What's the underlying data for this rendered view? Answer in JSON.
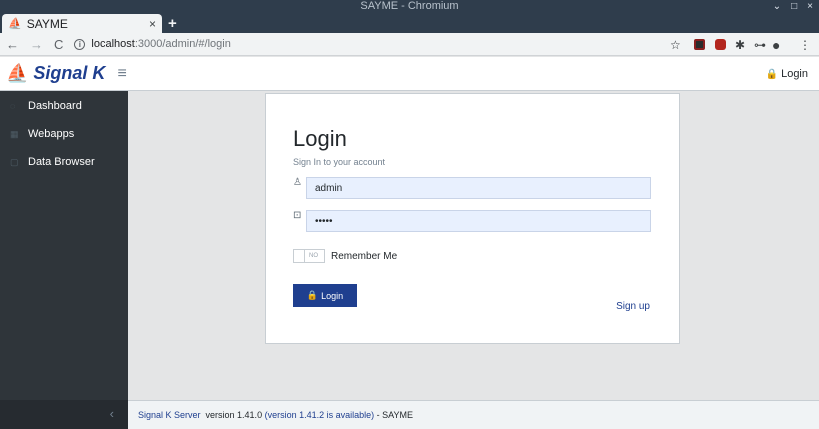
{
  "window": {
    "title": "SAYME - Chromium",
    "controls": [
      "⌄",
      "□",
      "×"
    ]
  },
  "browser": {
    "tab_title": "SAYME",
    "tab_close": "×",
    "new_tab": "+",
    "back": "←",
    "forward": "→",
    "reload": "C",
    "url_host": "localhost",
    "url_rest": ":3000/admin/#/login",
    "info": "i",
    "star": "☆",
    "key": "⊶",
    "profile": "●",
    "menu": "⋮",
    "puzzle": "✱"
  },
  "header": {
    "brand": "Signal K",
    "logo": "⛵",
    "menu_icon": "≡",
    "login_label": "Login",
    "lock": "🔒"
  },
  "sidebar": {
    "items": [
      {
        "label": "Dashboard",
        "icon": "◌"
      },
      {
        "label": "Webapps",
        "icon": "▦"
      },
      {
        "label": "Data Browser",
        "icon": "▢"
      }
    ],
    "collapse": "‹"
  },
  "login": {
    "title": "Login",
    "subtitle": "Sign In to your account",
    "username_value": "admin",
    "username_icon": "♙",
    "password_value": "•••••",
    "password_icon": "⊡",
    "toggle_text": "NO",
    "remember_label": "Remember Me",
    "button_label": "Login",
    "signup_label": "Sign up"
  },
  "footer": {
    "server_link": "Signal K Server",
    "version_text": "  version 1.41.0 ",
    "update_text": "(version 1.41.2 is available)",
    "suffix": " - SAYME"
  },
  "colors": {
    "accent": "#1f3f8f",
    "sidebar": "#2f353a"
  }
}
